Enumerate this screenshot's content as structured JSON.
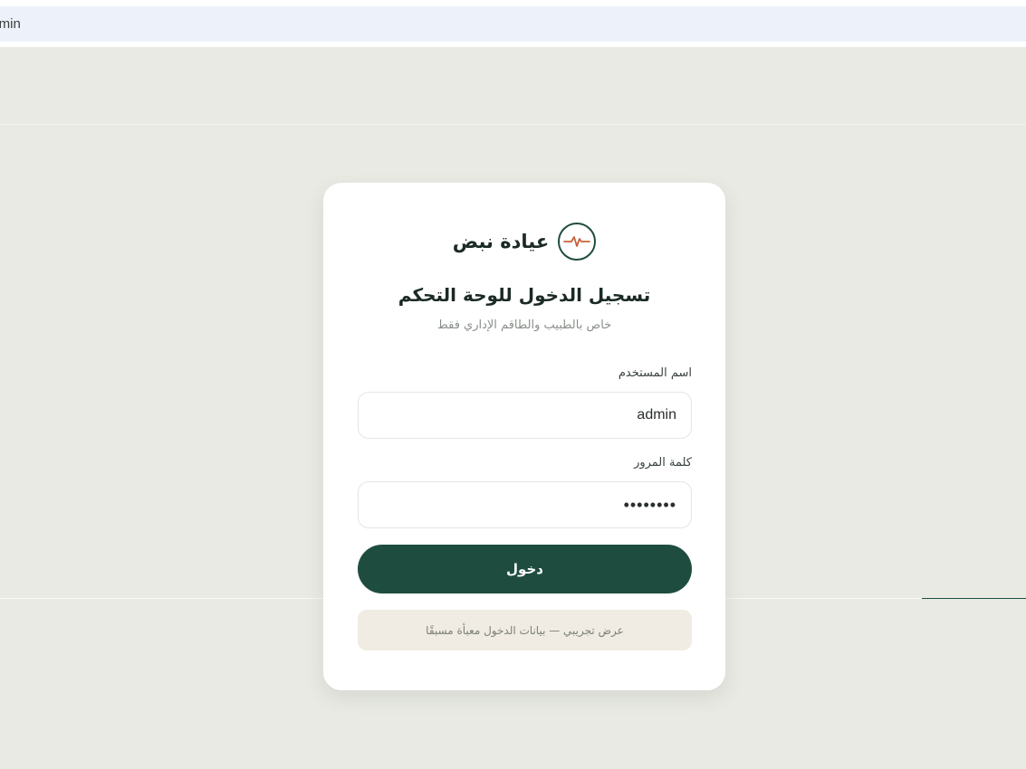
{
  "browser": {
    "address_text": "admin"
  },
  "brand": {
    "name": "عيادة نبض",
    "logo_icon": "pulse-icon",
    "accent_color": "#1e4d40",
    "pulse_color": "#c8623a"
  },
  "login": {
    "title": "تسجيل الدخول للوحة التحكم",
    "subtitle": "خاص بالطبيب والطاقم الإداري فقط",
    "username_label": "اسم المستخدم",
    "username_value": "admin",
    "password_label": "كلمة المرور",
    "password_value": "••••••••",
    "submit_label": "دخول",
    "demo_note": "عرض تجريبي — بيانات الدخول معبأة مسبقًا"
  }
}
